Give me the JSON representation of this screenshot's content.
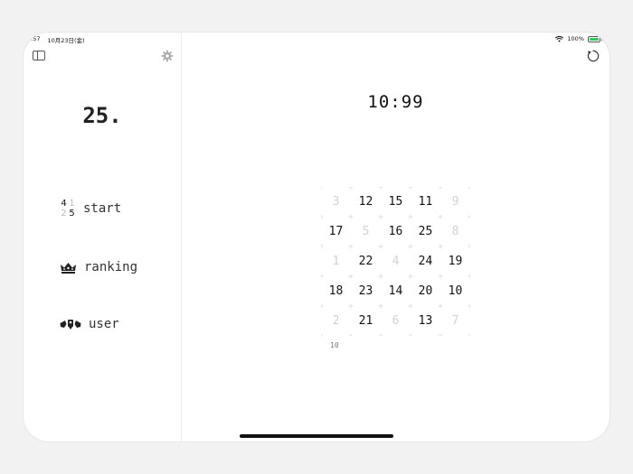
{
  "status_bar": {
    "time": ":57",
    "date": "10月23日(金)",
    "battery": "100%"
  },
  "sidebar": {
    "brand": "25.",
    "items": [
      {
        "label": "start",
        "icon": "number-grid-icon",
        "grid": [
          "4",
          "1",
          "2",
          "5"
        ]
      },
      {
        "label": "ranking",
        "icon": "crown-icon"
      },
      {
        "label": "user",
        "icon": "user-badge-icon"
      }
    ]
  },
  "main": {
    "timer": "10:99",
    "next_number": "10",
    "board": [
      [
        {
          "n": "3",
          "state": "faded"
        },
        {
          "n": "12",
          "state": "active"
        },
        {
          "n": "15",
          "state": "active"
        },
        {
          "n": "11",
          "state": "active"
        },
        {
          "n": "9",
          "state": "faded"
        }
      ],
      [
        {
          "n": "17",
          "state": "active"
        },
        {
          "n": "5",
          "state": "faded"
        },
        {
          "n": "16",
          "state": "active"
        },
        {
          "n": "25",
          "state": "active"
        },
        {
          "n": "8",
          "state": "faded"
        }
      ],
      [
        {
          "n": "1",
          "state": "faded"
        },
        {
          "n": "22",
          "state": "active"
        },
        {
          "n": "4",
          "state": "faded"
        },
        {
          "n": "24",
          "state": "active"
        },
        {
          "n": "19",
          "state": "active"
        }
      ],
      [
        {
          "n": "18",
          "state": "active"
        },
        {
          "n": "23",
          "state": "active"
        },
        {
          "n": "14",
          "state": "active"
        },
        {
          "n": "20",
          "state": "active"
        },
        {
          "n": "10",
          "state": "active"
        }
      ],
      [
        {
          "n": "2",
          "state": "faded"
        },
        {
          "n": "21",
          "state": "active"
        },
        {
          "n": "6",
          "state": "faded"
        },
        {
          "n": "13",
          "state": "active"
        },
        {
          "n": "7",
          "state": "faded"
        }
      ]
    ]
  },
  "colors": {
    "active_text": "#111111",
    "faded_text": "#d2d2d2",
    "grid_mark": "#d9d9d9"
  }
}
